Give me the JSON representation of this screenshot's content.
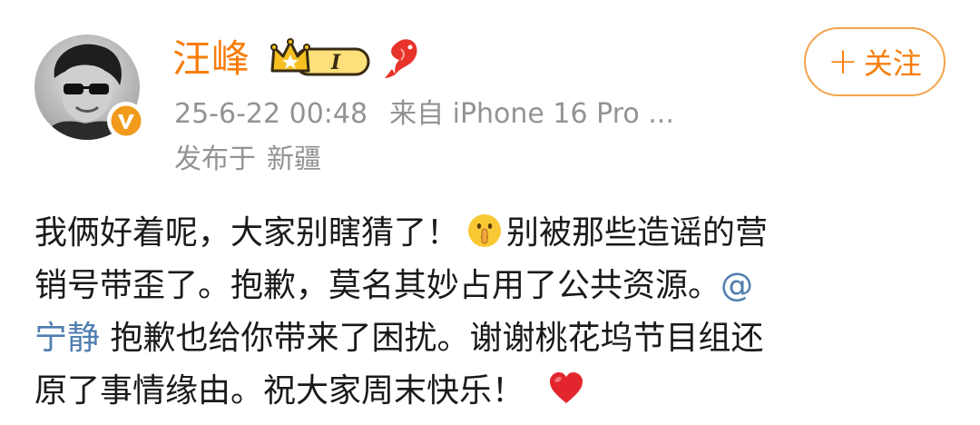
{
  "post": {
    "author": {
      "name": "汪峰",
      "avatar_icon": "user-avatar",
      "verified_icon": "verified-v-icon",
      "member_badge_level": "I",
      "member_badge_icon": "crown-member-badge-icon",
      "fan_badge_icon": "koi-fish-icon"
    },
    "timestamp": "25-6-22 00:48",
    "source": "来自 iPhone 16 Pro ...",
    "location_label": "发布于",
    "location": "新疆",
    "follow_button": {
      "plus": "+",
      "label": "关注"
    },
    "content": {
      "line1_a": "我俩好着呢，大家别瞎猜了！",
      "emoji1": "shushing-face-emoji",
      "line1_b": "别被那些造谣的营",
      "line2_a": "销号带歪了。抱歉，莫名其妙占用了公共资源。",
      "line2_mention": "@",
      "line3_mention": "宁静",
      "line3_b": " 抱歉也给你带来了困扰。谢谢桃花坞节目组还",
      "line4_a": "原了事情缘由。祝大家周末快乐！",
      "emoji2": "red-heart-emoji"
    },
    "colors": {
      "username": "#f77d0a",
      "follow_border": "#f4a34c",
      "meta": "#939393",
      "mention": "#507daf",
      "text": "#1a1a1a"
    }
  }
}
